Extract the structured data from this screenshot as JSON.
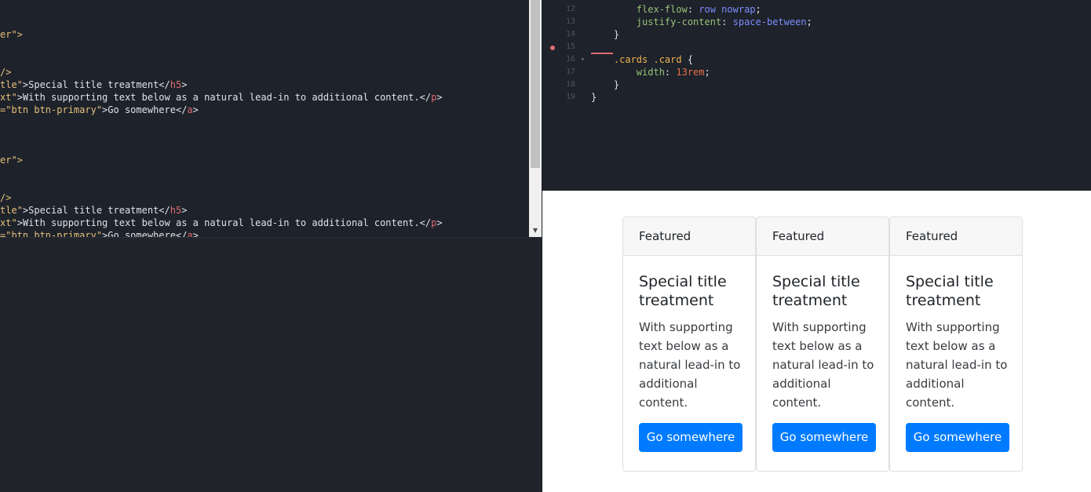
{
  "html_editor": {
    "lines": [
      [
        {
          "t": "er\">",
          "c": "str2"
        }
      ],
      [],
      [],
      [
        {
          "t": "/>",
          "c": "str2"
        }
      ],
      [
        {
          "t": "tle\"",
          "c": "str"
        },
        {
          "t": ">Special title treatment</",
          "c": "txt"
        },
        {
          "t": "h5",
          "c": "tag"
        },
        {
          "t": ">",
          "c": "txt"
        }
      ],
      [
        {
          "t": "xt\"",
          "c": "str"
        },
        {
          "t": ">With supporting text below as a natural lead-in to additional content.</",
          "c": "txt"
        },
        {
          "t": "p",
          "c": "tag"
        },
        {
          "t": ">",
          "c": "txt"
        }
      ],
      [
        {
          "t": "=\"btn btn-primary\"",
          "c": "str"
        },
        {
          "t": ">Go somewhere</",
          "c": "txt"
        },
        {
          "t": "a",
          "c": "tag"
        },
        {
          "t": ">",
          "c": "txt"
        }
      ],
      [],
      [],
      [],
      [
        {
          "t": "er\">",
          "c": "str2"
        }
      ],
      [],
      [],
      [
        {
          "t": "/>",
          "c": "str2"
        }
      ],
      [
        {
          "t": "tle\"",
          "c": "str"
        },
        {
          "t": ">Special title treatment</",
          "c": "txt"
        },
        {
          "t": "h5",
          "c": "tag"
        },
        {
          "t": ">",
          "c": "txt"
        }
      ],
      [
        {
          "t": "xt\"",
          "c": "str"
        },
        {
          "t": ">With supporting text below as a natural lead-in to additional content.</",
          "c": "txt"
        },
        {
          "t": "p",
          "c": "tag"
        },
        {
          "t": ">",
          "c": "txt"
        }
      ],
      [
        {
          "t": "=\"btn btn-primary\"",
          "c": "str"
        },
        {
          "t": ">Go somewhere</",
          "c": "txt"
        },
        {
          "t": "a",
          "c": "tag"
        },
        {
          "t": ">",
          "c": "txt"
        }
      ]
    ]
  },
  "css_editor": {
    "lines": [
      {
        "num": "12",
        "fold": "",
        "code": [
          {
            "t": "        ",
            "c": "punc"
          },
          {
            "t": "flex-flow",
            "c": "prop"
          },
          {
            "t": ": ",
            "c": "punc"
          },
          {
            "t": "row nowrap",
            "c": "val"
          },
          {
            "t": ";",
            "c": "punc"
          }
        ]
      },
      {
        "num": "13",
        "fold": "",
        "code": [
          {
            "t": "        ",
            "c": "punc"
          },
          {
            "t": "justify-content",
            "c": "prop"
          },
          {
            "t": ": ",
            "c": "punc"
          },
          {
            "t": "space-between",
            "c": "val"
          },
          {
            "t": ";",
            "c": "punc"
          }
        ]
      },
      {
        "num": "14",
        "fold": "",
        "code": [
          {
            "t": "    }",
            "c": "punc"
          }
        ]
      },
      {
        "num": "15",
        "fold": "",
        "code": []
      },
      {
        "num": "16",
        "fold": "▾",
        "code": [
          {
            "t": "    ",
            "c": "punc"
          },
          {
            "t": ".cards .card",
            "c": "sel"
          },
          {
            "t": " {",
            "c": "punc"
          }
        ]
      },
      {
        "num": "17",
        "fold": "",
        "code": [
          {
            "t": "        ",
            "c": "punc"
          },
          {
            "t": "width",
            "c": "prop"
          },
          {
            "t": ": ",
            "c": "punc"
          },
          {
            "t": "13rem",
            "c": "num"
          },
          {
            "t": ";",
            "c": "punc"
          }
        ]
      },
      {
        "num": "18",
        "fold": "",
        "code": [
          {
            "t": "    }",
            "c": "punc"
          }
        ]
      },
      {
        "num": "19",
        "fold": "",
        "code": [
          {
            "t": "}",
            "c": "punc"
          }
        ]
      }
    ]
  },
  "preview": {
    "cards": [
      {
        "header": "Featured",
        "title": "Special title treatment",
        "text": "With supporting text below as a natural lead-in to additional content.",
        "button": "Go somewhere"
      },
      {
        "header": "Featured",
        "title": "Special title treatment",
        "text": "With supporting text below as a natural lead-in to additional content.",
        "button": "Go somewhere"
      },
      {
        "header": "Featured",
        "title": "Special title treatment",
        "text": "With supporting text below as a natural lead-in to additional content.",
        "button": "Go somewhere"
      }
    ]
  },
  "colors": {
    "editor_bg": "#1e222a",
    "string": "#e5c07b",
    "tag": "#e06c75",
    "property": "#98c379",
    "value": "#7c8dff",
    "number": "#e8704c",
    "selector": "#f0b354",
    "primary_button": "#007bff"
  },
  "icons": {
    "scroll_down": "▼",
    "error_marker": "error-dot-icon"
  }
}
